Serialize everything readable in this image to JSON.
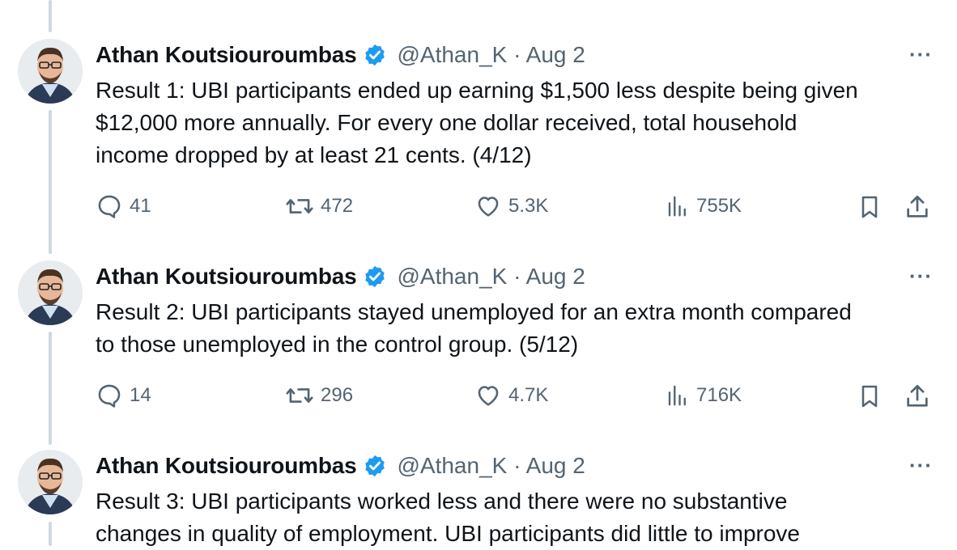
{
  "tweets": [
    {
      "author": "Athan Koutsiouroumbas",
      "handle": "@Athan_K · Aug 2",
      "text": "Result 1: UBI participants ended up earning $1,500 less despite being given\n$12,000 more annually. For every one dollar received, total household\nincome dropped by at least 21 cents. (4/12)",
      "replies": "41",
      "reposts": "472",
      "likes": "5.3K",
      "views": "755K",
      "more": "···"
    },
    {
      "author": "Athan Koutsiouroumbas",
      "handle": "@Athan_K · Aug 2",
      "text": "Result 2: UBI participants stayed unemployed for an extra month compared\nto those unemployed in the control group. (5/12)",
      "replies": "14",
      "reposts": "296",
      "likes": "4.7K",
      "views": "716K",
      "more": "···"
    },
    {
      "author": "Athan Koutsiouroumbas",
      "handle": "@Athan_K · Aug 2",
      "text": "Result 3: UBI participants worked less and there were no substantive\nchanges in quality of employment. UBI participants did little to improve",
      "more": "···"
    }
  ],
  "colors": {
    "verified": "#1d9bf0",
    "muted": "#536471",
    "thread_line": "#cfd9de"
  }
}
